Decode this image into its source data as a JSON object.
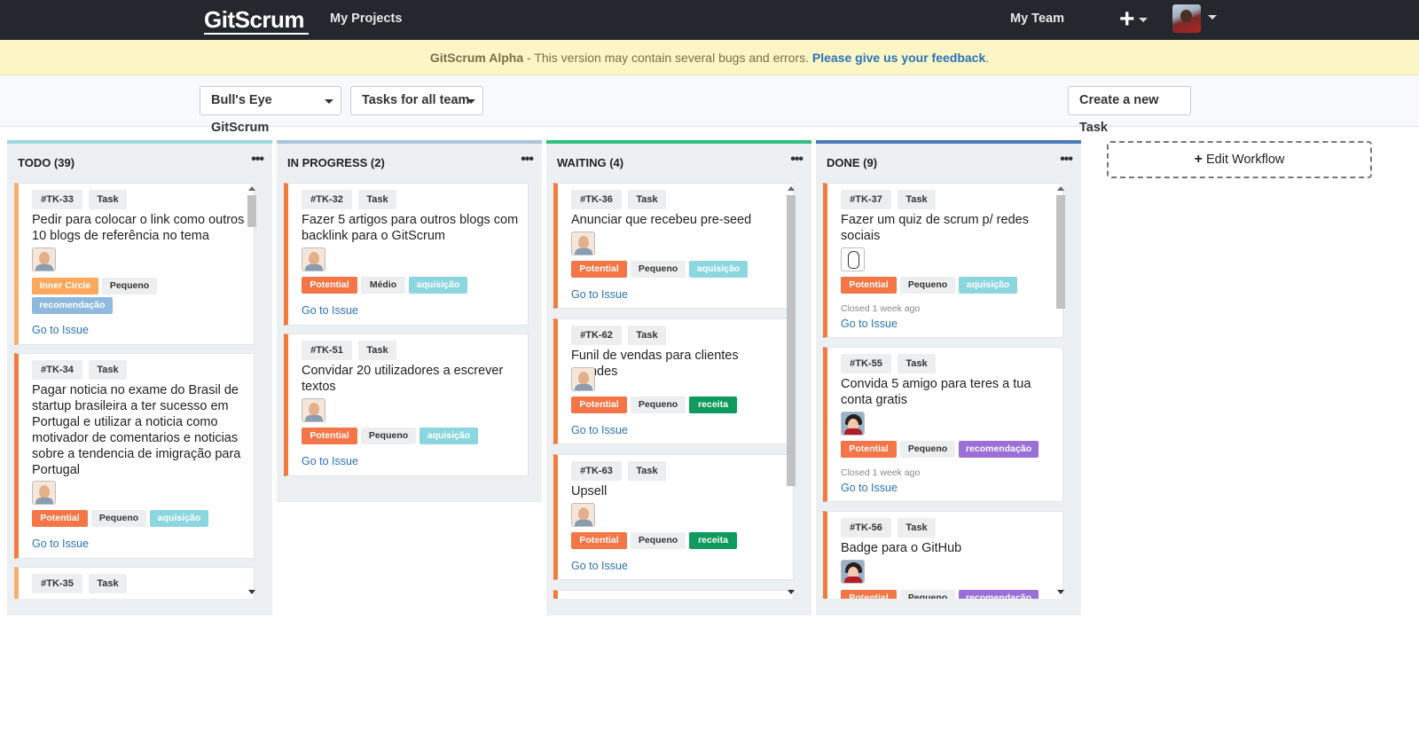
{
  "nav": {
    "logo": "GitScrum",
    "my_projects": "My Projects",
    "my_team": "My Team",
    "plus": "+"
  },
  "banner": {
    "strong": "GitScrum Alpha",
    "text": " - This version may contain several bugs and errors. ",
    "link": "Please give us your feedback",
    "end": "."
  },
  "toolbar": {
    "project": "Bull's Eye GitScrum",
    "filter": "Tasks for all team",
    "create": "Create a new Task"
  },
  "colors": {
    "todo": "#9ed8df",
    "in_progress": "#a9c6de",
    "waiting": "#2ec27e",
    "done": "#4a79b8"
  },
  "columns": [
    {
      "title": "TODO (39)",
      "dots": "•••",
      "cards": [
        {
          "id": "#TK-33",
          "type": "Task",
          "title": "Pedir para colocar o link como outros 10 blogs de referência no tema",
          "labels": [
            "Inner Circle",
            "Pequeno",
            "recomendação"
          ],
          "link": "Go to Issue"
        },
        {
          "id": "#TK-34",
          "type": "Task",
          "title": "Pagar noticia no exame do Brasil de startup brasileira a ter sucesso em Portugal e utilizar a noticia como motivador de comentarios e noticias sobre a tendencia de imigração para Portugal",
          "labels": [
            "Potential",
            "Pequeno",
            "aquisição"
          ],
          "link": "Go to Issue"
        },
        {
          "id": "#TK-35",
          "type": "Task"
        }
      ]
    },
    {
      "title": "IN PROGRESS (2)",
      "dots": "•••",
      "cards": [
        {
          "id": "#TK-32",
          "type": "Task",
          "title": "Fazer 5 artigos para outros blogs com backlink para o GitScrum",
          "labels": [
            "Potential",
            "Médio",
            "aquisição"
          ],
          "link": "Go to Issue"
        },
        {
          "id": "#TK-51",
          "type": "Task",
          "title": "Convidar 20 utilizadores a escrever textos",
          "labels": [
            "Potential",
            "Pequeno",
            "aquisição"
          ],
          "link": "Go to Issue"
        }
      ]
    },
    {
      "title": "WAITING (4)",
      "dots": "•••",
      "cards": [
        {
          "id": "#TK-36",
          "type": "Task",
          "title": "Anunciar que recebeu pre-seed",
          "labels": [
            "Potential",
            "Pequeno",
            "aquisição"
          ],
          "link": "Go to Issue"
        },
        {
          "id": "#TK-62",
          "type": "Task",
          "title": "Funil de vendas para clientes grandes",
          "labels": [
            "Potential",
            "Pequeno",
            "receita"
          ],
          "link": "Go to Issue"
        },
        {
          "id": "#TK-63",
          "type": "Task",
          "title": "Upsell",
          "labels": [
            "Potential",
            "Pequeno",
            "receita"
          ],
          "link": "Go to Issue"
        }
      ]
    },
    {
      "title": "DONE (9)",
      "dots": "•••",
      "cards": [
        {
          "id": "#TK-37",
          "type": "Task",
          "title": "Fazer um quiz de scrum p/ redes sociais",
          "labels": [
            "Potential",
            "Pequeno",
            "aquisição"
          ],
          "closed": "Closed 1 week ago",
          "link": "Go to Issue"
        },
        {
          "id": "#TK-55",
          "type": "Task",
          "title": "Convida 5 amigo para teres a tua conta gratis",
          "labels": [
            "Potential",
            "Pequeno",
            "recomendação"
          ],
          "closed": "Closed 1 week ago",
          "link": "Go to Issue"
        },
        {
          "id": "#TK-56",
          "type": "Task",
          "title": "Badge para o GitHub",
          "labels": [
            "Potential",
            "Pequeno",
            "recomendação"
          ]
        }
      ]
    }
  ],
  "edit_workflow": "Edit Workflow"
}
